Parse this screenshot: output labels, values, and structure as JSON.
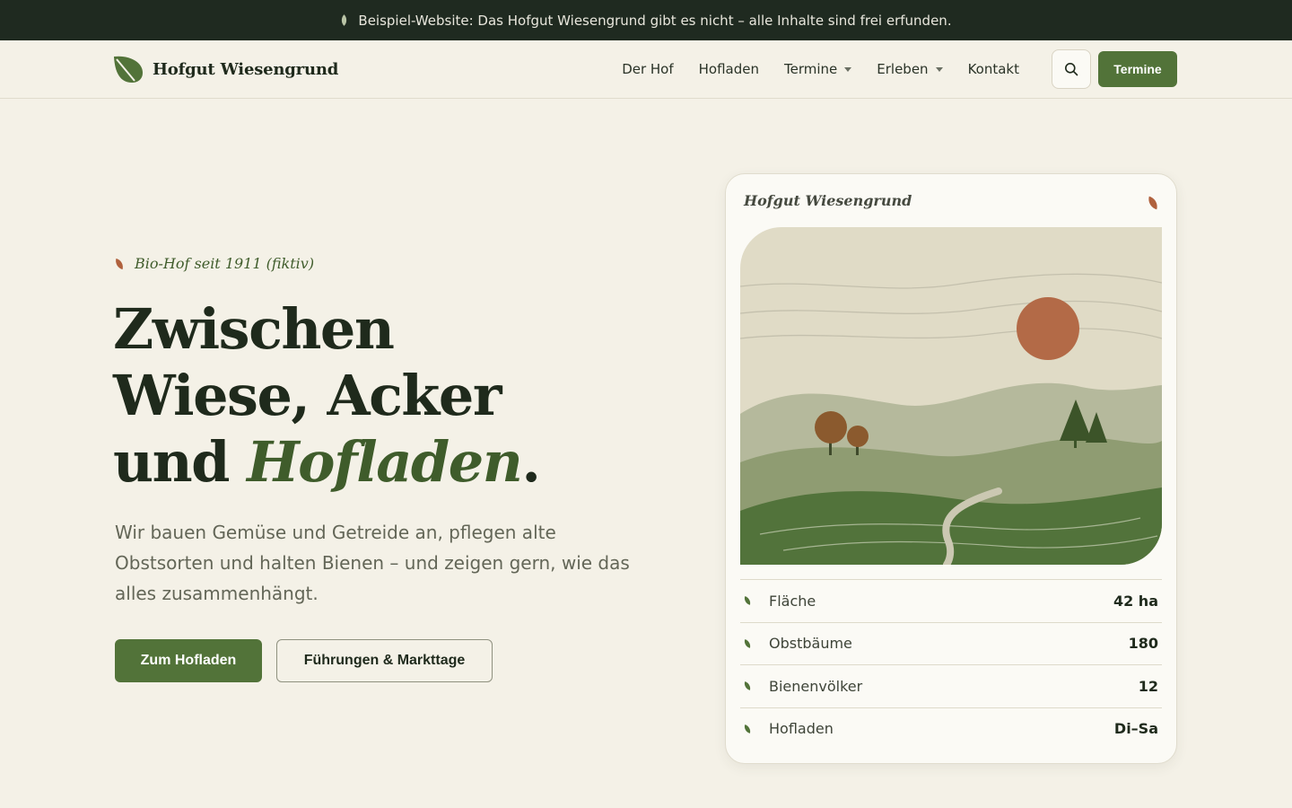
{
  "banner": {
    "text": "Beispiel-Website: Das Hofgut Wiesengrund gibt es nicht – alle Inhalte sind frei erfunden."
  },
  "header": {
    "brand": "Hofgut Wiesengrund",
    "nav": [
      {
        "label": "Der Hof",
        "dropdown": false
      },
      {
        "label": "Hofladen",
        "dropdown": false
      },
      {
        "label": "Termine",
        "dropdown": true
      },
      {
        "label": "Erleben",
        "dropdown": true
      },
      {
        "label": "Kontakt",
        "dropdown": false
      }
    ],
    "search_icon": "search-icon",
    "cta_label": "Termine"
  },
  "hero": {
    "eyebrow": "Bio-Hof seit 1911 (fiktiv)",
    "headline_line1": "Zwischen",
    "headline_line2": "Wiese, Acker",
    "headline_line3_prefix": "und ",
    "headline_emphasis": "Hofladen",
    "headline_suffix": ".",
    "lead": "Wir bauen Gemüse und Getreide an, pflegen alte Obstsorten und halten Bienen – und zeigen gern, wie das alles zusammenhängt.",
    "primary_button": "Zum Hofladen",
    "secondary_button": "Führungen & Markttage"
  },
  "card": {
    "title": "Hofgut Wiesengrund",
    "stats": [
      {
        "label": "Fläche",
        "value": "42 ha"
      },
      {
        "label": "Obstbäume",
        "value": "180"
      },
      {
        "label": "Bienenvölker",
        "value": "12"
      },
      {
        "label": "Hofladen",
        "value": "Di–Sa"
      }
    ]
  },
  "colors": {
    "accent": "#527339",
    "dark": "#1f2a20",
    "background": "#f4f1e7",
    "terracotta": "#b0613d"
  }
}
